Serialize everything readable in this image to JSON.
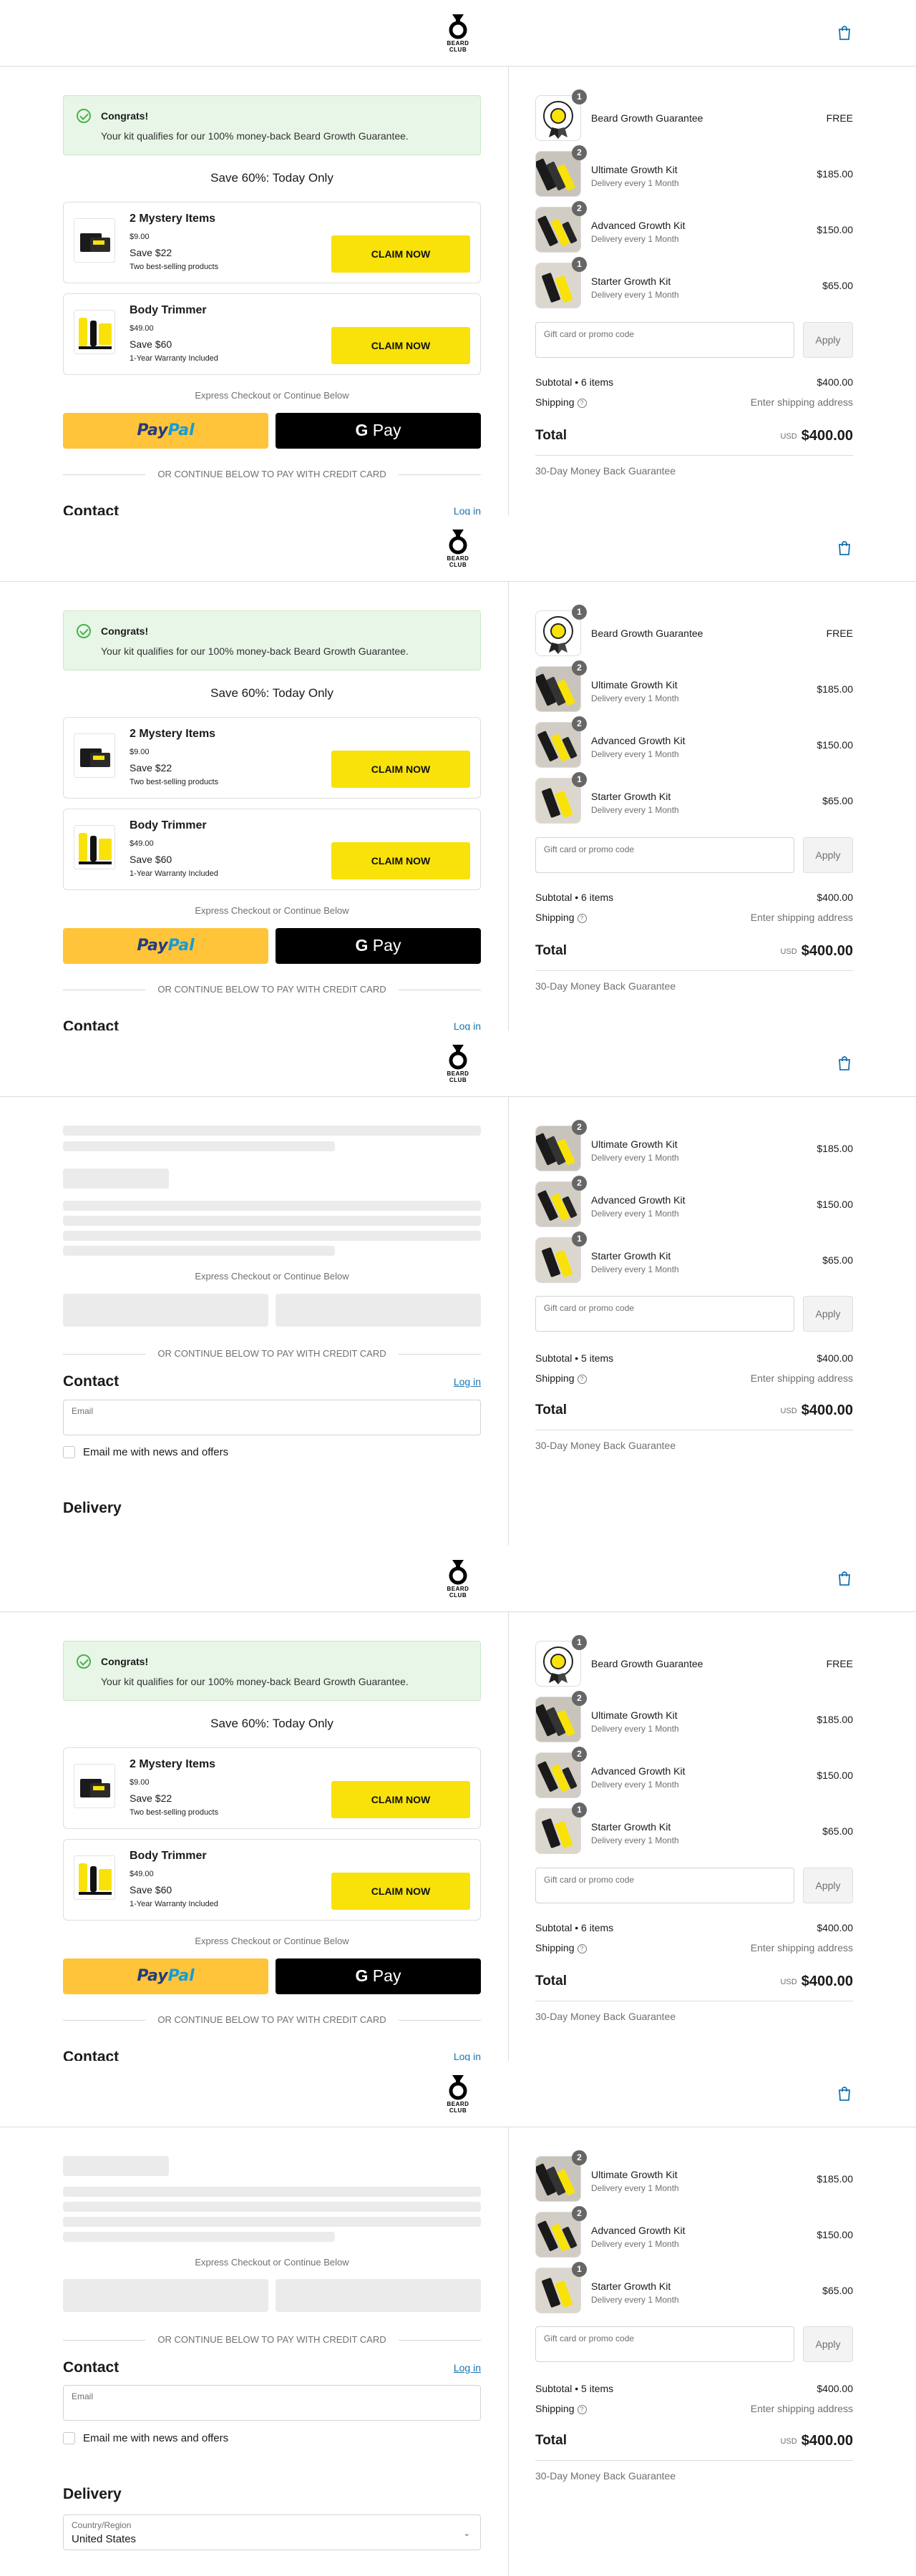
{
  "brand": {
    "logo_text_1": "BEARD",
    "logo_text_2": "CLUB"
  },
  "congrats": {
    "title": "Congrats!",
    "body": "Your kit qualifies for our 100% money-back Beard Growth Guarantee."
  },
  "save_heading": "Save 60%: Today Only",
  "offers": [
    {
      "name": "2 Mystery Items",
      "price": "$9.00",
      "save": "Save $22",
      "note": "Two best-selling products",
      "button": "CLAIM NOW"
    },
    {
      "name": "Body Trimmer",
      "price": "$49.00",
      "save": "Save $60",
      "note": "1-Year Warranty Included",
      "button": "CLAIM NOW"
    }
  ],
  "express_label": "Express Checkout or Continue Below",
  "paypal": {
    "part1": "Pay",
    "part2": "Pal"
  },
  "gpay": {
    "g": "G",
    "text": " Pay"
  },
  "or_text": "OR CONTINUE BELOW TO PAY WITH CREDIT CARD",
  "contact": {
    "heading": "Contact",
    "login": "Log in",
    "email_placeholder": "Email",
    "news_label": "Email me with news and offers"
  },
  "delivery": {
    "heading": "Delivery",
    "country_label": "Country/Region",
    "country_value": "United States"
  },
  "cart_items": {
    "guarantee": {
      "name": "Beard Growth Guarantee",
      "qty": "1",
      "price": "FREE"
    },
    "ultimate": {
      "name": "Ultimate Growth Kit",
      "sub": "Delivery every 1 Month",
      "qty": "2",
      "price": "$185.00"
    },
    "advanced": {
      "name": "Advanced Growth Kit",
      "sub": "Delivery every 1 Month",
      "qty": "2",
      "price": "$150.00"
    },
    "starter": {
      "name": "Starter Growth Kit",
      "sub": "Delivery every 1 Month",
      "qty": "1",
      "price": "$65.00"
    }
  },
  "promo": {
    "placeholder": "Gift card or promo code",
    "apply": "Apply"
  },
  "summary": {
    "subtotal_6": "Subtotal • 6 items",
    "subtotal_5": "Subtotal • 5 items",
    "subtotal_value": "$400.00",
    "shipping": "Shipping",
    "shipping_value": "Enter shipping address",
    "total": "Total",
    "currency": "USD",
    "total_value": "$400.00",
    "guarantee_note": "30-Day Money Back Guarantee"
  },
  "colors": {
    "accent_yellow": "#f8e20a",
    "paypal_yellow": "#ffc439",
    "link_blue": "#1773b0",
    "success_bg": "#e7f6e7"
  }
}
